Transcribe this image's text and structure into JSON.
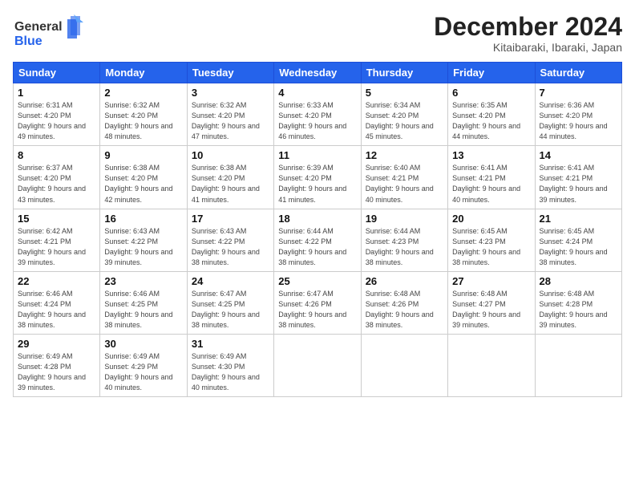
{
  "header": {
    "logo_line1": "General",
    "logo_line2": "Blue",
    "month": "December 2024",
    "location": "Kitaibaraki, Ibaraki, Japan"
  },
  "weekdays": [
    "Sunday",
    "Monday",
    "Tuesday",
    "Wednesday",
    "Thursday",
    "Friday",
    "Saturday"
  ],
  "weeks": [
    [
      {
        "day": "1",
        "sunrise": "Sunrise: 6:31 AM",
        "sunset": "Sunset: 4:20 PM",
        "daylight": "Daylight: 9 hours and 49 minutes."
      },
      {
        "day": "2",
        "sunrise": "Sunrise: 6:32 AM",
        "sunset": "Sunset: 4:20 PM",
        "daylight": "Daylight: 9 hours and 48 minutes."
      },
      {
        "day": "3",
        "sunrise": "Sunrise: 6:32 AM",
        "sunset": "Sunset: 4:20 PM",
        "daylight": "Daylight: 9 hours and 47 minutes."
      },
      {
        "day": "4",
        "sunrise": "Sunrise: 6:33 AM",
        "sunset": "Sunset: 4:20 PM",
        "daylight": "Daylight: 9 hours and 46 minutes."
      },
      {
        "day": "5",
        "sunrise": "Sunrise: 6:34 AM",
        "sunset": "Sunset: 4:20 PM",
        "daylight": "Daylight: 9 hours and 45 minutes."
      },
      {
        "day": "6",
        "sunrise": "Sunrise: 6:35 AM",
        "sunset": "Sunset: 4:20 PM",
        "daylight": "Daylight: 9 hours and 44 minutes."
      },
      {
        "day": "7",
        "sunrise": "Sunrise: 6:36 AM",
        "sunset": "Sunset: 4:20 PM",
        "daylight": "Daylight: 9 hours and 44 minutes."
      }
    ],
    [
      {
        "day": "8",
        "sunrise": "Sunrise: 6:37 AM",
        "sunset": "Sunset: 4:20 PM",
        "daylight": "Daylight: 9 hours and 43 minutes."
      },
      {
        "day": "9",
        "sunrise": "Sunrise: 6:38 AM",
        "sunset": "Sunset: 4:20 PM",
        "daylight": "Daylight: 9 hours and 42 minutes."
      },
      {
        "day": "10",
        "sunrise": "Sunrise: 6:38 AM",
        "sunset": "Sunset: 4:20 PM",
        "daylight": "Daylight: 9 hours and 41 minutes."
      },
      {
        "day": "11",
        "sunrise": "Sunrise: 6:39 AM",
        "sunset": "Sunset: 4:20 PM",
        "daylight": "Daylight: 9 hours and 41 minutes."
      },
      {
        "day": "12",
        "sunrise": "Sunrise: 6:40 AM",
        "sunset": "Sunset: 4:21 PM",
        "daylight": "Daylight: 9 hours and 40 minutes."
      },
      {
        "day": "13",
        "sunrise": "Sunrise: 6:41 AM",
        "sunset": "Sunset: 4:21 PM",
        "daylight": "Daylight: 9 hours and 40 minutes."
      },
      {
        "day": "14",
        "sunrise": "Sunrise: 6:41 AM",
        "sunset": "Sunset: 4:21 PM",
        "daylight": "Daylight: 9 hours and 39 minutes."
      }
    ],
    [
      {
        "day": "15",
        "sunrise": "Sunrise: 6:42 AM",
        "sunset": "Sunset: 4:21 PM",
        "daylight": "Daylight: 9 hours and 39 minutes."
      },
      {
        "day": "16",
        "sunrise": "Sunrise: 6:43 AM",
        "sunset": "Sunset: 4:22 PM",
        "daylight": "Daylight: 9 hours and 39 minutes."
      },
      {
        "day": "17",
        "sunrise": "Sunrise: 6:43 AM",
        "sunset": "Sunset: 4:22 PM",
        "daylight": "Daylight: 9 hours and 38 minutes."
      },
      {
        "day": "18",
        "sunrise": "Sunrise: 6:44 AM",
        "sunset": "Sunset: 4:22 PM",
        "daylight": "Daylight: 9 hours and 38 minutes."
      },
      {
        "day": "19",
        "sunrise": "Sunrise: 6:44 AM",
        "sunset": "Sunset: 4:23 PM",
        "daylight": "Daylight: 9 hours and 38 minutes."
      },
      {
        "day": "20",
        "sunrise": "Sunrise: 6:45 AM",
        "sunset": "Sunset: 4:23 PM",
        "daylight": "Daylight: 9 hours and 38 minutes."
      },
      {
        "day": "21",
        "sunrise": "Sunrise: 6:45 AM",
        "sunset": "Sunset: 4:24 PM",
        "daylight": "Daylight: 9 hours and 38 minutes."
      }
    ],
    [
      {
        "day": "22",
        "sunrise": "Sunrise: 6:46 AM",
        "sunset": "Sunset: 4:24 PM",
        "daylight": "Daylight: 9 hours and 38 minutes."
      },
      {
        "day": "23",
        "sunrise": "Sunrise: 6:46 AM",
        "sunset": "Sunset: 4:25 PM",
        "daylight": "Daylight: 9 hours and 38 minutes."
      },
      {
        "day": "24",
        "sunrise": "Sunrise: 6:47 AM",
        "sunset": "Sunset: 4:25 PM",
        "daylight": "Daylight: 9 hours and 38 minutes."
      },
      {
        "day": "25",
        "sunrise": "Sunrise: 6:47 AM",
        "sunset": "Sunset: 4:26 PM",
        "daylight": "Daylight: 9 hours and 38 minutes."
      },
      {
        "day": "26",
        "sunrise": "Sunrise: 6:48 AM",
        "sunset": "Sunset: 4:26 PM",
        "daylight": "Daylight: 9 hours and 38 minutes."
      },
      {
        "day": "27",
        "sunrise": "Sunrise: 6:48 AM",
        "sunset": "Sunset: 4:27 PM",
        "daylight": "Daylight: 9 hours and 39 minutes."
      },
      {
        "day": "28",
        "sunrise": "Sunrise: 6:48 AM",
        "sunset": "Sunset: 4:28 PM",
        "daylight": "Daylight: 9 hours and 39 minutes."
      }
    ],
    [
      {
        "day": "29",
        "sunrise": "Sunrise: 6:49 AM",
        "sunset": "Sunset: 4:28 PM",
        "daylight": "Daylight: 9 hours and 39 minutes."
      },
      {
        "day": "30",
        "sunrise": "Sunrise: 6:49 AM",
        "sunset": "Sunset: 4:29 PM",
        "daylight": "Daylight: 9 hours and 40 minutes."
      },
      {
        "day": "31",
        "sunrise": "Sunrise: 6:49 AM",
        "sunset": "Sunset: 4:30 PM",
        "daylight": "Daylight: 9 hours and 40 minutes."
      },
      null,
      null,
      null,
      null
    ]
  ]
}
